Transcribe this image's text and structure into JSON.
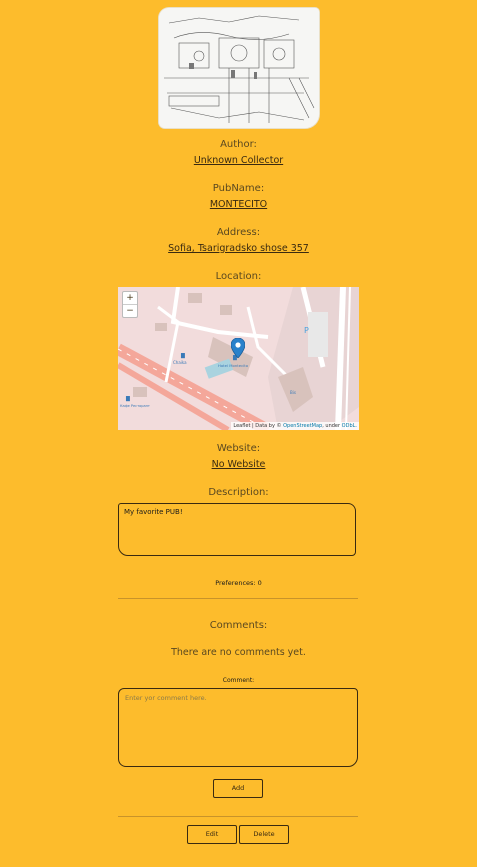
{
  "author": {
    "label": "Author:",
    "value": "Unknown Collector"
  },
  "pubname": {
    "label": "PubName:",
    "value": "MONTECITO"
  },
  "address": {
    "label": "Address:",
    "value": "Sofia, Tsarigradsko shose 357"
  },
  "location": {
    "label": "Location:",
    "map": {
      "zoom_in": "+",
      "zoom_out": "−",
      "marker_label": "Hotel Montecito",
      "poi_left": "Chaika",
      "poi_bottom_left": "Кафе Ресторант",
      "poi_bottom": "Bis",
      "parking": "P",
      "attribution_prefix": "Leaflet | Data by © ",
      "attribution_osm": "OpenStreetMap",
      "attribution_mid": ", under ",
      "attribution_odbl": "ODbL."
    }
  },
  "website": {
    "label": "Website:",
    "value": "No Website"
  },
  "description": {
    "label": "Description:",
    "value": "My favorite PUB!"
  },
  "preferences": {
    "label": "Preferences: 0"
  },
  "comments": {
    "heading": "Comments:",
    "empty": "There are no comments yet.",
    "field_label": "Comment:",
    "placeholder": "Enter yor comment here.",
    "add": "Add"
  },
  "actions": {
    "edit": "Edit",
    "delete": "Delete"
  }
}
